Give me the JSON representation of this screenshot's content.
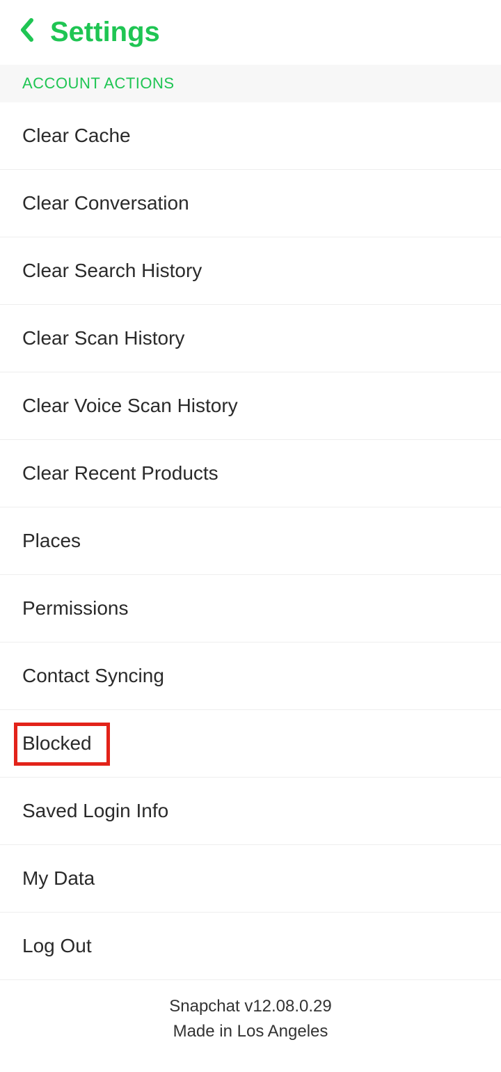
{
  "header": {
    "title": "Settings"
  },
  "section": {
    "title": "ACCOUNT ACTIONS"
  },
  "items": [
    {
      "label": "Clear Cache"
    },
    {
      "label": "Clear Conversation"
    },
    {
      "label": "Clear Search History"
    },
    {
      "label": "Clear Scan History"
    },
    {
      "label": "Clear Voice Scan History"
    },
    {
      "label": "Clear Recent Products"
    },
    {
      "label": "Places"
    },
    {
      "label": "Permissions"
    },
    {
      "label": "Contact Syncing"
    },
    {
      "label": "Blocked"
    },
    {
      "label": "Saved Login Info"
    },
    {
      "label": "My Data"
    },
    {
      "label": "Log Out"
    }
  ],
  "footer": {
    "line1": "Snapchat v12.08.0.29",
    "line2": "Made in Los Angeles"
  }
}
